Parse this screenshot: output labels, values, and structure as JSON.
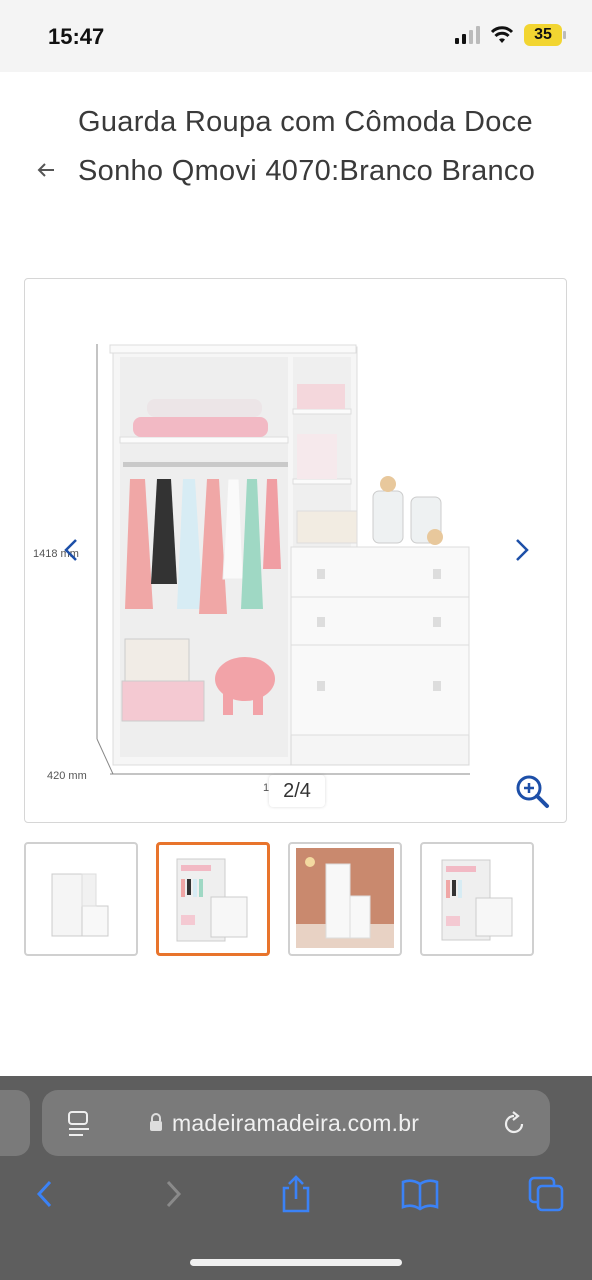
{
  "status_bar": {
    "time": "15:47",
    "battery": "35"
  },
  "header": {
    "title": "Guarda Roupa com Cômoda Doce Sonho Qmovi 4070:Branco Branco"
  },
  "gallery": {
    "counter": "2/4",
    "dim_height": "1418 mm",
    "dim_depth": "420 mm",
    "dim_width_partial": "1"
  },
  "thumbnails": [
    {
      "label": "thumbnail-1",
      "selected": false
    },
    {
      "label": "thumbnail-2",
      "selected": true
    },
    {
      "label": "thumbnail-3",
      "selected": false
    },
    {
      "label": "thumbnail-4",
      "selected": false
    }
  ],
  "browser": {
    "url": "madeiramadeira.com.br"
  },
  "colors": {
    "accent": "#e8742c",
    "nav_blue": "#1d4fa8",
    "safari_blue": "#3b82f6"
  }
}
